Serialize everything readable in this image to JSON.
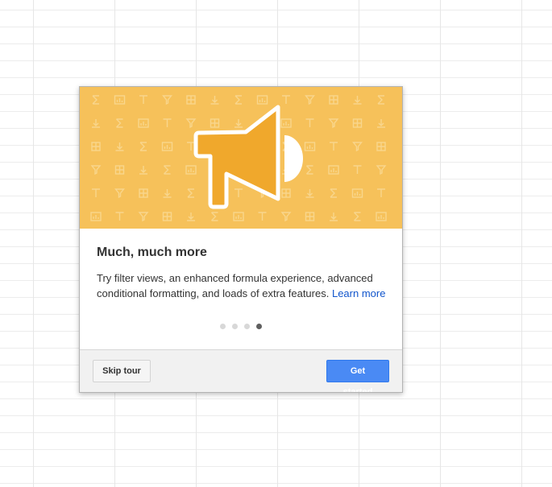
{
  "tour_dialog": {
    "title": "Much, much more",
    "description": "Try filter views, an enhanced formula experience, advanced conditional formatting, and loads of extra features.",
    "learn_more_label": "Learn more",
    "pagination": {
      "total_steps": 4,
      "current_step": 4
    },
    "skip_label": "Skip tour",
    "get_started_label": "Get started",
    "banner_icon": "megaphone-icon",
    "pattern_icons": [
      "sum-icon",
      "chart-icon",
      "freeze-icon",
      "filter-icon",
      "border-icon",
      "sort-icon"
    ]
  },
  "colors": {
    "banner_background": "#f6c15a",
    "megaphone": "#f0a82c",
    "primary_button": "#4a8af4",
    "link": "#1155cc",
    "active_dot": "#5f5f5f",
    "inactive_dot": "#d8d8d8"
  }
}
